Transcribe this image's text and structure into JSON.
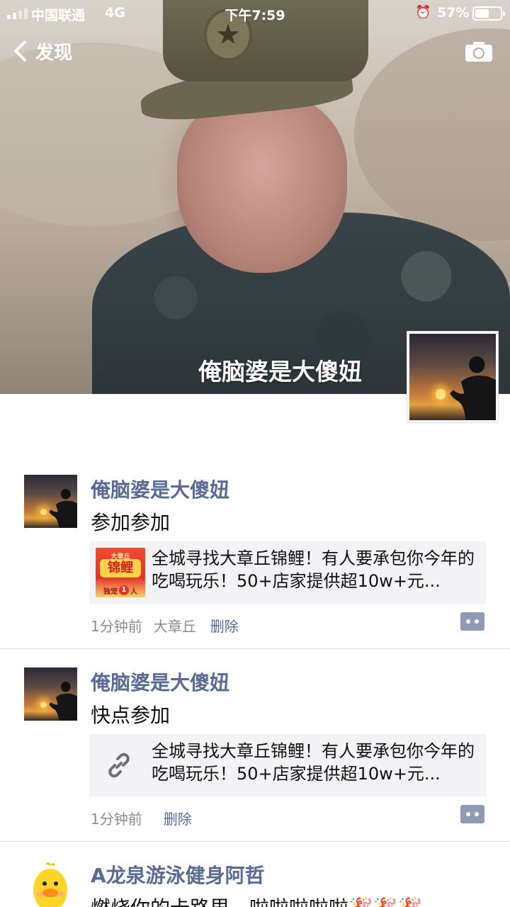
{
  "status_bar": {
    "carrier": "中国联通",
    "network": "4G",
    "time": "下午7:59",
    "battery": "57%",
    "battery_level": 0.57
  },
  "nav": {
    "back_label": "发现"
  },
  "profile": {
    "name": "俺脑婆是大傻妞"
  },
  "posts": [
    {
      "name": "俺脑婆是大傻妞",
      "text": "参加参加",
      "link_title": "全城寻找大章丘锦鲤！有人要承包你今年的吃喝玩乐！50+店家提供超10w+元...",
      "thumb_text_top": "大章丘",
      "thumb_text_mid": "锦鲤",
      "thumb_text_bottom": "独宠",
      "thumb_text_num": "1",
      "thumb_text_end": "人",
      "time": "1分钟前",
      "location": "大章丘",
      "delete_label": "删除"
    },
    {
      "name": "俺脑婆是大傻妞",
      "text": "快点参加",
      "link_title": "全城寻找大章丘锦鲤！有人要承包你今年的吃喝玩乐！50+店家提供超10w+元...",
      "time": "1分钟前",
      "delete_label": "删除"
    },
    {
      "name": "A龙泉游泳健身阿哲",
      "text": "燃烧你的卡路里，啦啦啦啦啦🎉🎉🎉"
    }
  ],
  "colors": {
    "link_blue": "#576b95",
    "card_bg": "#f3f3f5",
    "meta_gray": "#8c8c8c"
  },
  "icons": {
    "back": "chevron-left-icon",
    "camera": "camera-icon",
    "link": "link-icon",
    "more": "comment-more-icon"
  }
}
